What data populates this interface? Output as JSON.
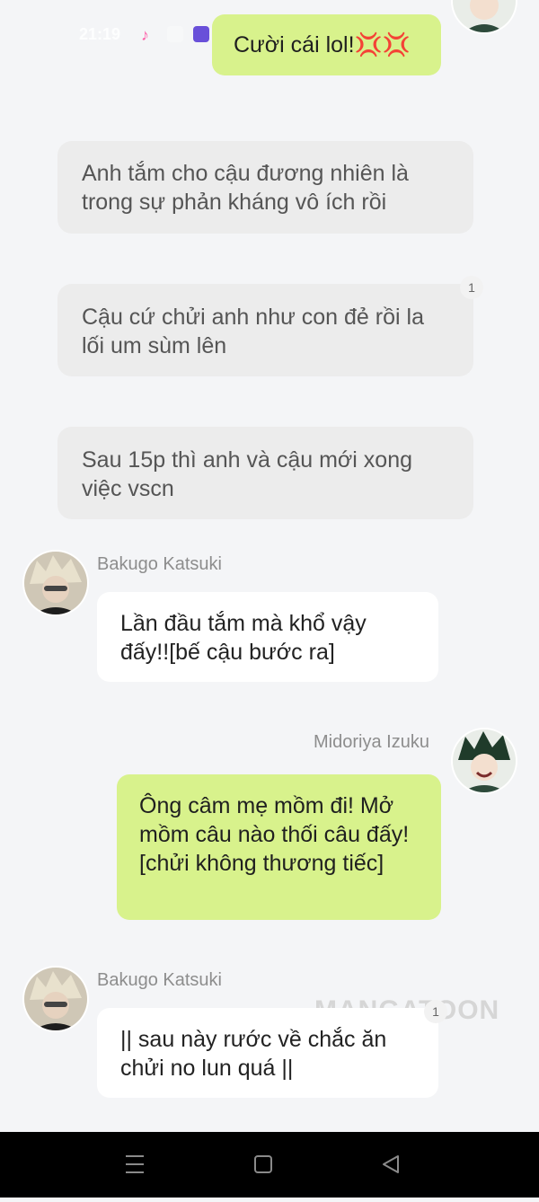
{
  "status_bar": {
    "time": "21:19"
  },
  "messages": [
    {
      "id": "m1",
      "side": "right",
      "text": "Cười cái lol!💢💢"
    },
    {
      "id": "n1",
      "side": "narration",
      "text": "Anh tắm cho cậu đương nhiên là trong sự phản kháng vô ích rồi"
    },
    {
      "id": "n2",
      "side": "narration",
      "text": "Cậu cứ chửi anh như con đẻ rồi la lối um sùm lên",
      "badge": "1"
    },
    {
      "id": "n3",
      "side": "narration",
      "text": "Sau 15p thì anh và cậu mới xong việc vscn"
    },
    {
      "id": "m2",
      "side": "left",
      "sender": "Bakugo Katsuki",
      "text": "Lần đầu tắm mà khổ vậy đấy!![bế cậu bước ra]"
    },
    {
      "id": "m3",
      "side": "right",
      "sender": "Midoriya Izuku",
      "text": "Ông câm mẹ mồm đi! Mở mồm câu nào thối câu đấy! [chửi không thương tiếc]"
    },
    {
      "id": "m4",
      "side": "left",
      "sender": "Bakugo Katsuki",
      "text": "|| sau này rước về chắc ăn chửi no lun quá ||",
      "badge": "1"
    }
  ],
  "watermark": "MANGATOON",
  "nav": {
    "menu": "menu-icon",
    "home": "square-home-icon",
    "back": "triangle-back-icon"
  },
  "colors": {
    "green_bubble": "#d8f28c",
    "narration_bubble": "#ececec",
    "background": "#f4f5f7"
  }
}
